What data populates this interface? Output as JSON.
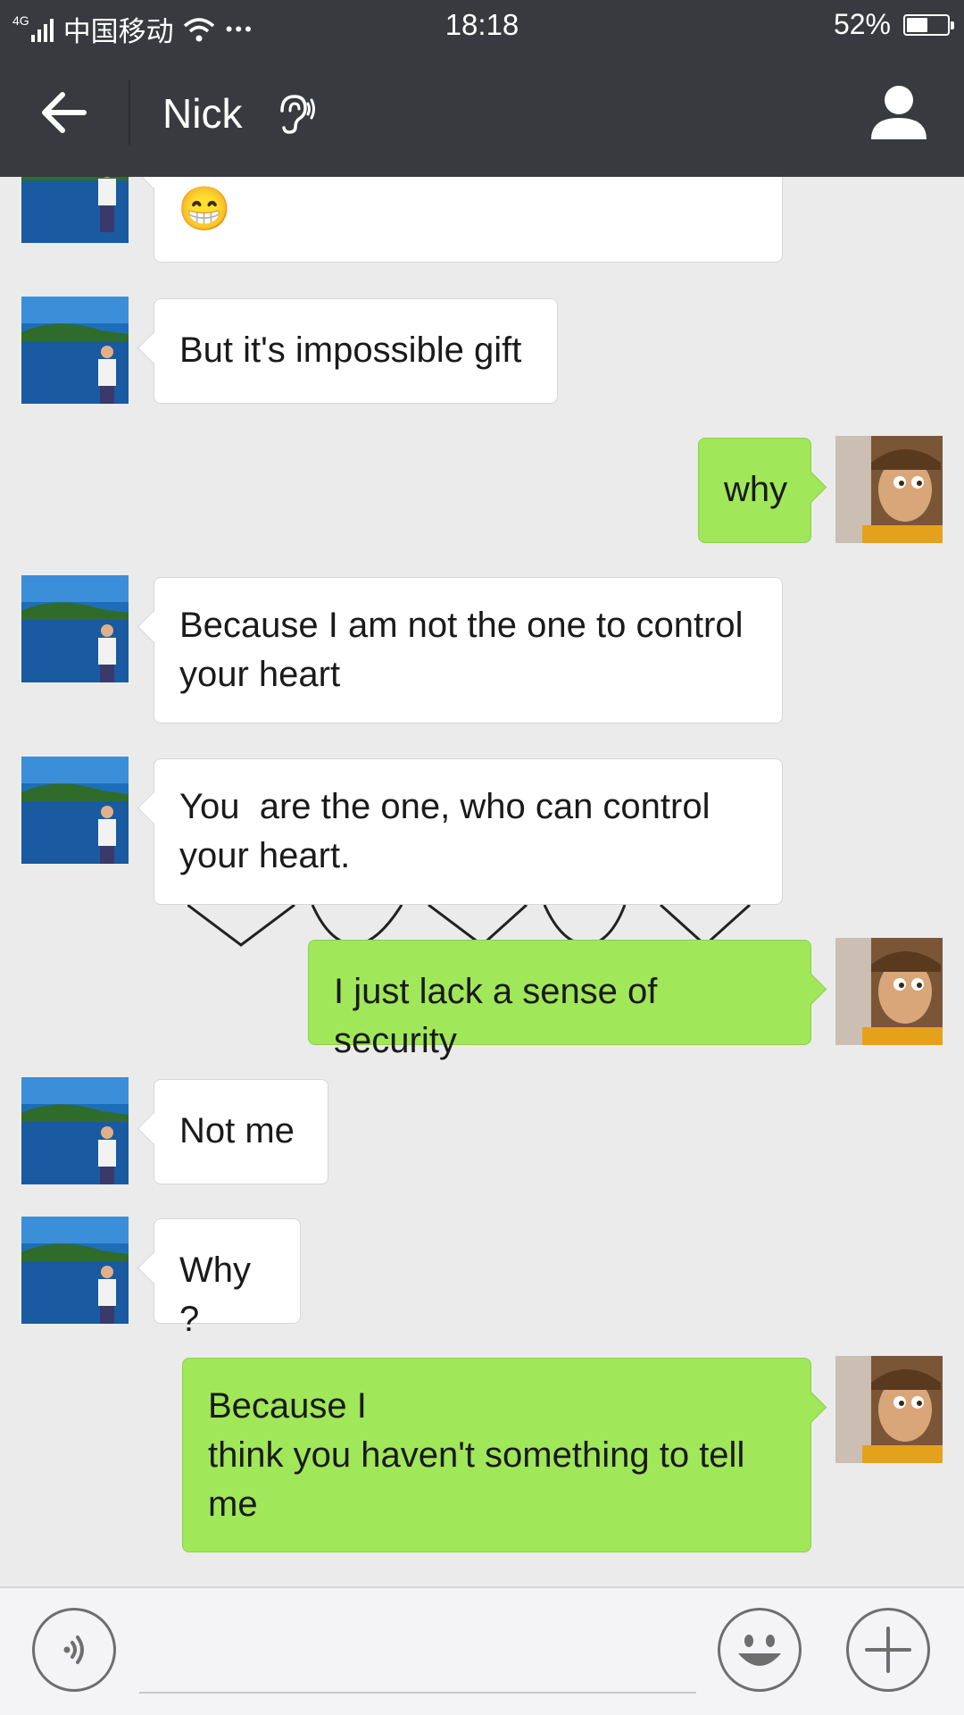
{
  "status_bar": {
    "network": "4G",
    "carrier": "中国移动",
    "dots": "•••",
    "time": "18:18",
    "battery_percent": "52%",
    "battery_level": 0.52
  },
  "header": {
    "title": "Nick",
    "icons": [
      "back-arrow-icon",
      "earpiece-icon",
      "profile-icon"
    ]
  },
  "messages": [
    {
      "side": "in",
      "text": "",
      "emoji": "😁"
    },
    {
      "side": "in",
      "text": "But it's impossible gift"
    },
    {
      "side": "out",
      "text": "why"
    },
    {
      "side": "in",
      "text": "Because I am not the one to control\nyour heart"
    },
    {
      "side": "in",
      "text": "You  are the one, who can control\nyour heart."
    },
    {
      "side": "out",
      "text": "I just lack a sense of security"
    },
    {
      "side": "in",
      "text": "Not me"
    },
    {
      "side": "in",
      "text": "Why ?"
    },
    {
      "side": "out",
      "text": "Because I\nthink you haven't something to tell\nme"
    }
  ],
  "input_bar": {
    "icons": [
      "voice-icon",
      "emoji-icon",
      "plus-icon"
    ],
    "text": ""
  },
  "colors": {
    "header_bg": "#393a3f",
    "outgoing_bubble": "#a0e75a",
    "incoming_bubble": "#ffffff",
    "chat_bg": "#ebebeb"
  }
}
